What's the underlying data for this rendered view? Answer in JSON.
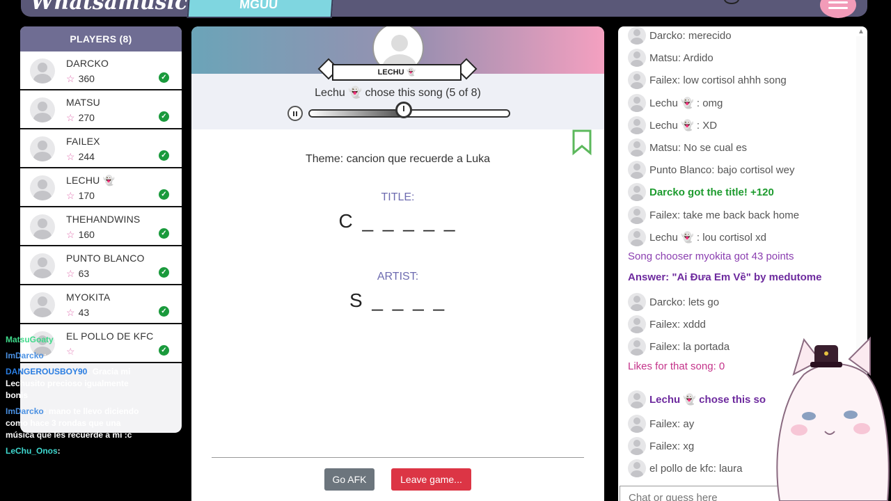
{
  "header": {
    "logo": "Whatsamusic",
    "room": "MGUU"
  },
  "players": {
    "title": "PLAYERS (8)",
    "list": [
      {
        "name": "DARCKO",
        "score": "360"
      },
      {
        "name": "MATSU",
        "score": "270"
      },
      {
        "name": "FAILEX",
        "score": "244"
      },
      {
        "name": "LECHU 👻",
        "score": "170"
      },
      {
        "name": "THEHANDWINS",
        "score": "160"
      },
      {
        "name": "PUNTO BLANCO",
        "score": "63"
      },
      {
        "name": "MYOKITA",
        "score": "43"
      },
      {
        "name": "EL POLLO DE KFC",
        "score": ""
      }
    ]
  },
  "overlay_chat": [
    {
      "user": "MatsuGoaty",
      "text": "si",
      "color": "#3fd98a"
    },
    {
      "user": "ImDarcko",
      "text": "si soy de Honduras we",
      "color": "#4a90e2"
    },
    {
      "user": "DANGEROUSBOY90",
      "text": "Gracia mi Lechusito precioso igualmente bonis",
      "color": "#2a7de1"
    },
    {
      "user": "ImDarcko",
      "text": "mano te llevo diciendo como hace 3 rondas que una música que les recuerde a mi :c",
      "color": "#4a90e2"
    },
    {
      "user": "LeChu_Onos",
      "text": "",
      "color": "#3fd9d0"
    }
  ],
  "game": {
    "chooser_name": "LECHU 👻",
    "chose_text": "Lechu 👻 chose this song (5 of 8)",
    "progress": 0.5,
    "theme": "Theme: cancion que recuerde a Luka",
    "title_label": "TITLE:",
    "title_hint": "C _ _ _ _ _",
    "artist_label": "ARTIST:",
    "artist_hint": "S _ _ _ _",
    "afk_label": "Go AFK",
    "leave_label": "Leave game..."
  },
  "chat": {
    "messages": [
      {
        "text": "Darcko: merecido",
        "type": "normal",
        "avatar": true
      },
      {
        "text": "Matsu: Ardido",
        "type": "normal",
        "avatar": true
      },
      {
        "text": "Failex: low cortisol ahhh song",
        "type": "normal",
        "avatar": true
      },
      {
        "text": "Lechu 👻 : omg",
        "type": "normal",
        "avatar": true
      },
      {
        "text": "Lechu 👻 : XD",
        "type": "normal",
        "avatar": true
      },
      {
        "text": "Matsu: No se cual es",
        "type": "normal",
        "avatar": true
      },
      {
        "text": "Punto Blanco: bajo cortisol wey",
        "type": "normal",
        "avatar": true
      },
      {
        "text": "Darcko got the title! +120",
        "type": "green",
        "avatar": true
      },
      {
        "text": "Failex: take me back back home",
        "type": "normal",
        "avatar": true
      },
      {
        "text": "Lechu 👻 : lou cortisol xd",
        "type": "normal",
        "avatar": true
      },
      {
        "text": "Song chooser myokita got 43 points",
        "type": "purple",
        "avatar": false
      },
      {
        "text": "Answer: \"Ai Đưa Em Về\" by medutome",
        "type": "purple-b",
        "avatar": false
      },
      {
        "text": "Darcko: lets go",
        "type": "normal",
        "avatar": true
      },
      {
        "text": "Failex: xddd",
        "type": "normal",
        "avatar": true
      },
      {
        "text": "Failex: la portada",
        "type": "normal",
        "avatar": true
      },
      {
        "text": "Likes for that song: 0",
        "type": "pink",
        "avatar": false
      },
      {
        "text": "Lechu 👻 chose this so",
        "type": "chose-line",
        "avatar": true
      },
      {
        "text": "Failex: ay",
        "type": "normal",
        "avatar": true
      },
      {
        "text": "Failex: xg",
        "type": "normal",
        "avatar": true
      },
      {
        "text": "el pollo de kfc: laura",
        "type": "normal",
        "avatar": true
      }
    ],
    "input_placeholder": "Chat or guess here"
  }
}
